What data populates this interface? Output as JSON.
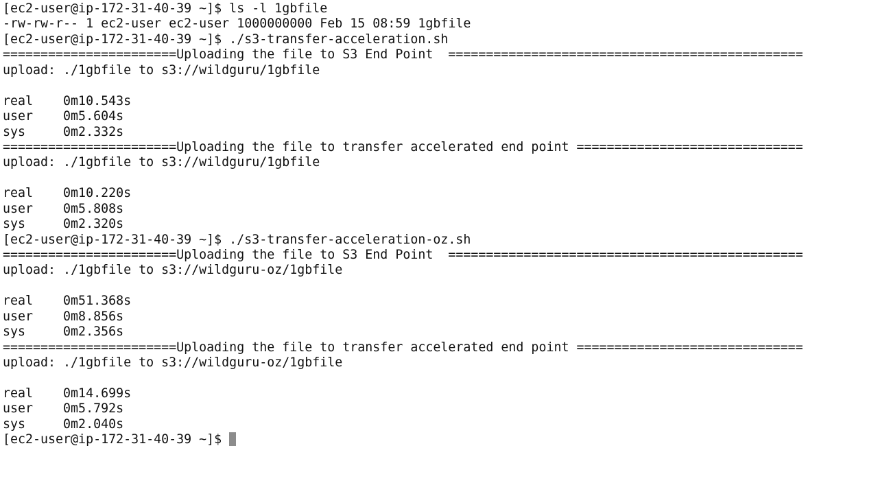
{
  "terminal": {
    "lines": [
      "[ec2-user@ip-172-31-40-39 ~]$ ls -l 1gbfile",
      "-rw-rw-r-- 1 ec2-user ec2-user 1000000000 Feb 15 08:59 1gbfile",
      "[ec2-user@ip-172-31-40-39 ~]$ ./s3-transfer-acceleration.sh",
      "=======================Uploading the file to S3 End Point  ===============================================",
      "upload: ./1gbfile to s3://wildguru/1gbfile",
      "",
      "real    0m10.543s",
      "user    0m5.604s",
      "sys     0m2.332s",
      "=======================Uploading the file to transfer accelerated end point ==============================",
      "upload: ./1gbfile to s3://wildguru/1gbfile",
      "",
      "real    0m10.220s",
      "user    0m5.808s",
      "sys     0m2.320s",
      "[ec2-user@ip-172-31-40-39 ~]$ ./s3-transfer-acceleration-oz.sh",
      "=======================Uploading the file to S3 End Point  ===============================================",
      "upload: ./1gbfile to s3://wildguru-oz/1gbfile",
      "",
      "real    0m51.368s",
      "user    0m8.856s",
      "sys     0m2.356s",
      "=======================Uploading the file to transfer accelerated end point ==============================",
      "upload: ./1gbfile to s3://wildguru-oz/1gbfile",
      "",
      "real    0m14.699s",
      "user    0m5.792s",
      "sys     0m2.040s"
    ],
    "prompt": "[ec2-user@ip-172-31-40-39 ~]$ "
  }
}
